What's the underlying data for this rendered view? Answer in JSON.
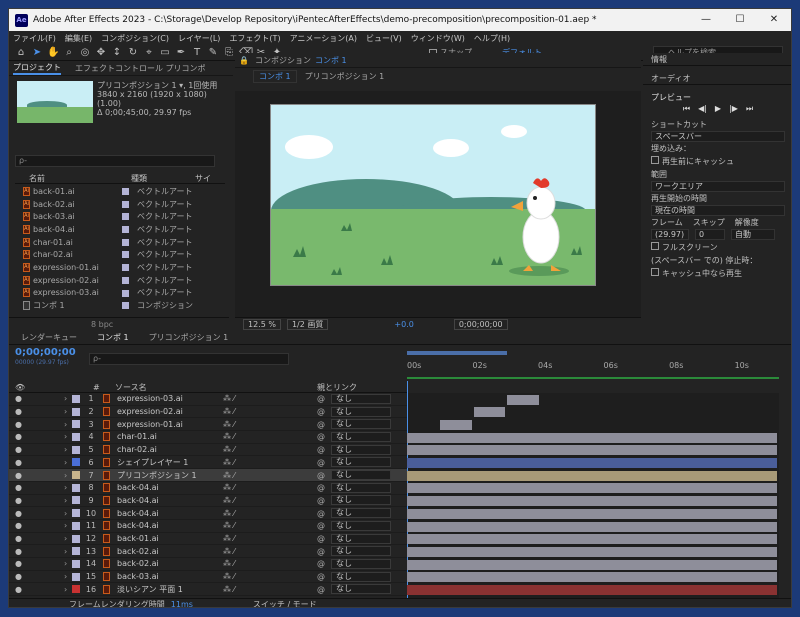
{
  "window": {
    "app_icon": "Ae",
    "title": "Adobe After Effects 2023 - C:\\Storage\\Develop Repository\\iPentecAfterEffects\\demo-precomposition\\precomposition-01.aep *",
    "minimize": "—",
    "maximize": "☐",
    "close": "✕"
  },
  "menu": [
    "ファイル(F)",
    "編集(E)",
    "コンポジション(C)",
    "レイヤー(L)",
    "エフェクト(T)",
    "アニメーション(A)",
    "ビュー(V)",
    "ウィンドウ(W)",
    "ヘルプ(H)"
  ],
  "toolbar": {
    "snap_label": "スナップ",
    "workspace": "デフォルト",
    "search_placeholder": "ヘルプを検索"
  },
  "project": {
    "tabs": [
      "プロジェクト",
      "エフェクトコントロール プリコンポ"
    ],
    "item_name": "プリコンポジション 1 ▾, 1回使用",
    "item_size": "3840 x 2160 (1920 x 1080) (1.00)",
    "item_duration": "Δ 0;00;45;00, 29.97 fps",
    "search_placeholder": "ρ-",
    "col_name": "名前",
    "col_type": "種類",
    "col_size": "サイ",
    "items": [
      {
        "name": "back-01.ai",
        "type": "ベクトルアート"
      },
      {
        "name": "back-02.ai",
        "type": "ベクトルアート"
      },
      {
        "name": "back-03.ai",
        "type": "ベクトルアート"
      },
      {
        "name": "back-04.ai",
        "type": "ベクトルアート"
      },
      {
        "name": "char-01.ai",
        "type": "ベクトルアート"
      },
      {
        "name": "char-02.ai",
        "type": "ベクトルアート"
      },
      {
        "name": "expression-01.ai",
        "type": "ベクトルアート"
      },
      {
        "name": "expression-02.ai",
        "type": "ベクトルアート"
      },
      {
        "name": "expression-03.ai",
        "type": "ベクトルアート"
      },
      {
        "name": "コンポ 1",
        "type": "コンポジション"
      }
    ],
    "bpc": "8 bpc"
  },
  "composition": {
    "tab_label": "コンポジション",
    "tab_comp": "コンポ 1",
    "breadcrumbs": [
      "コンポ 1",
      "プリコンポジション 1"
    ],
    "zoom": "12.5 %",
    "resolution": "1/2 画質",
    "exposure": "+0.0",
    "timecode": "0;00;00;00"
  },
  "right_panel": {
    "info": "情報",
    "audio": "オーディオ",
    "preview": "プレビュー",
    "preview_controls": [
      "⏮",
      "◀|",
      "▶",
      "|▶",
      "⏭"
    ],
    "shortcut_label": "ショートカット",
    "shortcut_value": "スペースバー",
    "include_label": "埋め込み：",
    "cache_label": "再生前にキャッシュ",
    "range_label": "範囲",
    "range_value": "ワークエリア",
    "play_from_label": "再生開始の時間",
    "play_from_value": "現在の時間",
    "frame_label": "フレーム",
    "skip_label": "スキップ",
    "res_label": "解像度",
    "frame_value": "(29.97)",
    "skip_value": "0",
    "res_value": "自動",
    "fullscreen_label": "フルスクリーン",
    "stop_label": "(スペースバー での) 停止時：",
    "stop_cache_label": "キャッシュ中なら再生"
  },
  "timeline": {
    "tabs": [
      "レンダーキュー",
      "コンポ 1",
      "プリコンポジション 1"
    ],
    "timecode": "0;00;00;00",
    "timecode_sub": "00000 (29.97 fps)",
    "search_placeholder": "ρ-",
    "col_source": "ソース名",
    "col_parent": "親とリンク",
    "ruler": [
      "00s",
      "02s",
      "04s",
      "06s",
      "08s",
      "10s"
    ],
    "layers": [
      {
        "num": "1",
        "name": "expression-03.ai",
        "color": "#b4b4d6",
        "parent": "なし",
        "bar_start": 0.27,
        "bar_end": 0.36,
        "selected": false
      },
      {
        "num": "2",
        "name": "expression-02.ai",
        "color": "#b4b4d6",
        "parent": "なし",
        "bar_start": 0.18,
        "bar_end": 0.27,
        "selected": false
      },
      {
        "num": "3",
        "name": "expression-01.ai",
        "color": "#b4b4d6",
        "parent": "なし",
        "bar_start": 0.09,
        "bar_end": 0.18,
        "selected": false
      },
      {
        "num": "4",
        "name": "char-01.ai",
        "color": "#b4b4d6",
        "parent": "なし",
        "bar_start": 0.0,
        "bar_end": 1.0,
        "selected": false
      },
      {
        "num": "5",
        "name": "char-02.ai",
        "color": "#b4b4d6",
        "parent": "なし",
        "bar_start": 0.0,
        "bar_end": 1.0,
        "selected": false
      },
      {
        "num": "6",
        "name": "シェイプレイヤー 1",
        "color": "#4a6ed6",
        "parent": "なし",
        "bar_start": 0.0,
        "bar_end": 1.0,
        "selected": false
      },
      {
        "num": "7",
        "name": "プリコンポジション 1",
        "color": "#c8b48c",
        "parent": "なし",
        "bar_start": 0.0,
        "bar_end": 1.0,
        "selected": true
      },
      {
        "num": "8",
        "name": "back-04.ai",
        "color": "#b4b4d6",
        "parent": "なし",
        "bar_start": 0.0,
        "bar_end": 1.0,
        "selected": false
      },
      {
        "num": "9",
        "name": "back-04.ai",
        "color": "#b4b4d6",
        "parent": "なし",
        "bar_start": 0.0,
        "bar_end": 1.0,
        "selected": false
      },
      {
        "num": "10",
        "name": "back-04.ai",
        "color": "#b4b4d6",
        "parent": "なし",
        "bar_start": 0.0,
        "bar_end": 1.0,
        "selected": false
      },
      {
        "num": "11",
        "name": "back-04.ai",
        "color": "#b4b4d6",
        "parent": "なし",
        "bar_start": 0.0,
        "bar_end": 1.0,
        "selected": false
      },
      {
        "num": "12",
        "name": "back-01.ai",
        "color": "#b4b4d6",
        "parent": "なし",
        "bar_start": 0.0,
        "bar_end": 1.0,
        "selected": false
      },
      {
        "num": "13",
        "name": "back-02.ai",
        "color": "#b4b4d6",
        "parent": "なし",
        "bar_start": 0.0,
        "bar_end": 1.0,
        "selected": false
      },
      {
        "num": "14",
        "name": "back-02.ai",
        "color": "#b4b4d6",
        "parent": "なし",
        "bar_start": 0.0,
        "bar_end": 1.0,
        "selected": false
      },
      {
        "num": "15",
        "name": "back-03.ai",
        "color": "#b4b4d6",
        "parent": "なし",
        "bar_start": 0.0,
        "bar_end": 1.0,
        "selected": false
      },
      {
        "num": "16",
        "name": "淡いシアン 平面 1",
        "color": "#c83232",
        "parent": "なし",
        "bar_start": 0.0,
        "bar_end": 1.0,
        "selected": false
      }
    ],
    "footer_label": "フレームレンダリング時間",
    "footer_time": "11ms",
    "footer_switch": "スイッチ / モード"
  }
}
